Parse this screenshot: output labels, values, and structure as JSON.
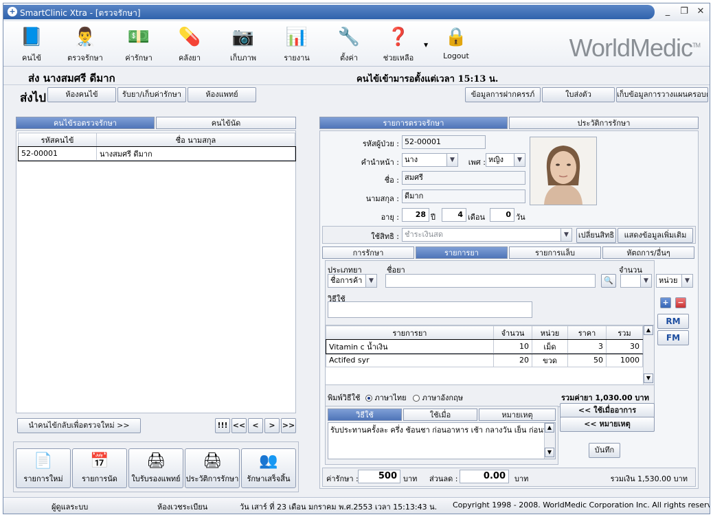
{
  "window": {
    "title": "SmartClinic Xtra - [ตรวจรักษา]",
    "min": "_",
    "restore": "❐",
    "close": "✕"
  },
  "toolbar": {
    "items": [
      {
        "label": "คนไข้",
        "icon": "📘"
      },
      {
        "label": "ตรวจรักษา",
        "icon": "👨‍⚕️"
      },
      {
        "label": "ค่ารักษา",
        "icon": "💵"
      },
      {
        "label": "คลังยา",
        "icon": "💊"
      },
      {
        "label": "เก็บภาพ",
        "icon": "📷"
      },
      {
        "label": "รายงาน",
        "icon": "📊"
      },
      {
        "label": "ตั้งค่า",
        "icon": "🔧"
      },
      {
        "label": "ช่วยเหลือ",
        "icon": "❓"
      },
      {
        "label": "Logout",
        "icon": "🔒"
      }
    ],
    "brand": "WorldMedic",
    "brand_tm": "TM"
  },
  "header": {
    "send": "ส่ง นางสมศรี ดีมาก",
    "arrival": "คนไข้เข้ามารอตั้งแต่เวลา 15:13 น."
  },
  "nav": {
    "sendto": "ส่งไป",
    "left_buttons": [
      "ห้องคนไข้",
      "รับยา/เก็บค่ารักษา",
      "ห้องแพทย์"
    ],
    "right_buttons": [
      "ข้อมูลการฝากครรภ์",
      "ใบส่งตัว",
      "เก็บข้อมูลการวางแผนครอบค"
    ]
  },
  "left": {
    "tabs": [
      "คนไข้รอตรวจรักษา",
      "คนไข้นัด"
    ],
    "columns": [
      "รหัสคนไข้",
      "ชื่อ นามสกุล"
    ],
    "rows": [
      [
        "52-00001",
        "นางสมศรี ดีมาก"
      ]
    ],
    "return_button": "นำคนไข้กลับเพื่อตรวจใหม่ >>",
    "pager": [
      "!!!",
      "<<",
      "<",
      ">",
      ">>"
    ],
    "big_buttons": [
      {
        "label": "รายการใหม่",
        "icon": "📄"
      },
      {
        "label": "รายการนัด",
        "icon": "📅"
      },
      {
        "label": "ใบรับรองแพทย์",
        "icon": "🖨"
      },
      {
        "label": "ประวัติการรักษา",
        "icon": "🖨"
      },
      {
        "label": "รักษาเสร็จสิ้น",
        "icon": "👥"
      }
    ]
  },
  "right": {
    "tabs": [
      "รายการตรวจรักษา",
      "ประวัติการรักษา"
    ],
    "patient": {
      "id_label": "รหัสผู้ป่วย :",
      "id": "52-00001",
      "prefix_label": "คำนำหน้า :",
      "prefix": "นาง",
      "sex_label": "เพศ :",
      "sex": "หญิง",
      "first_label": "ชื่อ :",
      "first": "สมศรี",
      "last_label": "นามสกุล :",
      "last": "ดีมาก",
      "age_label": "อายุ :",
      "years": "28",
      "years_unit": "ปี",
      "months": "4",
      "months_unit": "เดือน",
      "days": "0",
      "days_unit": "วัน"
    },
    "rights": {
      "label": "ใช้สิทธิ :",
      "value": "ชำระเงินสด",
      "change": "เปลี่ยนสิทธิ",
      "more": "แสดงข้อมูลเพิ่มเติม"
    },
    "subtabs": [
      "การรักษา",
      "รายการยา",
      "รายการแล็บ",
      "หัตถการ/อื่นๆ"
    ],
    "drug_form": {
      "type_label": "ประเภทยา",
      "type_value": "ชื่อการค้า",
      "name_label": "ชื่อยา",
      "qty_label": "จำนวน",
      "unit_value": "หน่วย",
      "usage_label": "วิธีใช้",
      "rm": "RM",
      "fm": "FM"
    },
    "drug_table": {
      "columns": [
        "รายการยา",
        "จำนวน",
        "หน่วย",
        "ราคา",
        "รวม"
      ],
      "rows": [
        [
          "Vitamin c น้ำเงิน",
          "10",
          "เม็ด",
          "3",
          "30"
        ],
        [
          "Actifed syr",
          "20",
          "ขวด",
          "50",
          "1000"
        ]
      ]
    },
    "print_usage_label": "พิมพ์วิธีใช้",
    "lang_thai": "ภาษาไทย",
    "lang_eng": "ภาษาอังกฤษ",
    "drug_total": "รวมค่ายา 1,030.00 บาท",
    "usage_tabs": [
      "วิธีใช้",
      "ใช้เมื่อ",
      "หมายเหตุ"
    ],
    "usage_text": "รับประทานครั้งละ ครึ่ง ช้อนชา ก่อนอาหาร เช้า กลางวัน เย็น ก่อนนอน",
    "when_button": "<<          ใช้เมื่ออาการ",
    "note_button": "<<          หมายเหตุ",
    "save_button": "บันทึก",
    "fee_label": "ค่ารักษา :",
    "fee": "500",
    "baht1": "บาท",
    "discount_label": "ส่วนลด :",
    "discount": "0.00",
    "baht2": "บาท",
    "grand_total": "รวมเงิน 1,530.00 บาท"
  },
  "status": {
    "user": "ผู้ดูแลระบบ",
    "room": "ห้องเวชระเบียน",
    "datetime": "วัน เสาร์ ที่ 23 เดือน มกราคม พ.ศ.2553 เวลา 15:13:43 น.",
    "copyright": "Copyright 1998 - 2008. WorldMedic Corporation Inc. All rights reserved."
  }
}
